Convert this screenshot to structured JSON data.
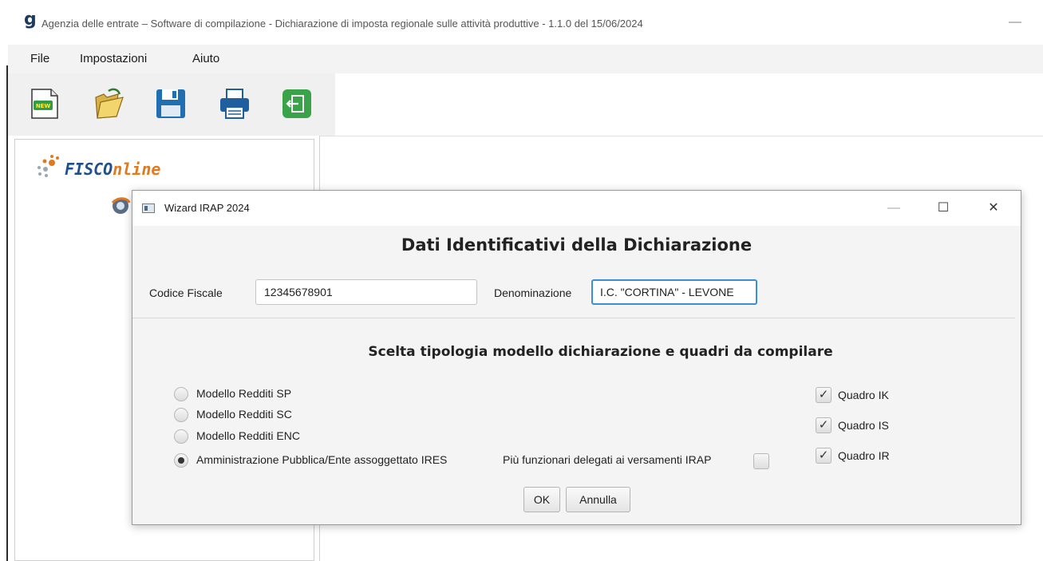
{
  "app": {
    "logo_glyph": "g",
    "title": "Agenzia delle entrate – Software di compilazione - Dichiarazione di imposta regionale sulle attività produttive - 1.1.0 del 15/06/2024",
    "minimize_glyph": "—"
  },
  "menu": {
    "items": [
      "File",
      "Impostazioni",
      "Aiuto"
    ]
  },
  "toolbar": {
    "buttons": [
      {
        "icon": "new-document-icon",
        "badge": "NEW"
      },
      {
        "icon": "open-folder-icon"
      },
      {
        "icon": "save-floppy-icon"
      },
      {
        "icon": "print-icon"
      },
      {
        "icon": "exit-icon"
      }
    ]
  },
  "sidebar": {
    "logo_text_a": "FISCO",
    "logo_text_b": "nline"
  },
  "dialog": {
    "title": "Wizard IRAP 2024",
    "controls": {
      "minimize": "—",
      "maximize": "☐",
      "close": "✕"
    },
    "heading": "Dati Identificativi della Dichiarazione",
    "codice_fiscale_label": "Codice Fiscale",
    "codice_fiscale_value": "12345678901",
    "denominazione_label": "Denominazione",
    "denominazione_value": "I.C. \"CORTINA\" - LEVONE",
    "subheading": "Scelta tipologia modello dichiarazione e quadri da compilare",
    "models": [
      {
        "label": "Modello Redditi SP",
        "checked": false
      },
      {
        "label": "Modello Redditi SC",
        "checked": false
      },
      {
        "label": "Modello Redditi ENC",
        "checked": false
      },
      {
        "label": "Amministrazione Pubblica/Ente assoggettato IRES",
        "checked": true
      }
    ],
    "delegati_label": "Più funzionari delegati ai versamenti IRAP",
    "delegati_checked": false,
    "quadri": [
      {
        "label": "Quadro IK",
        "checked": true
      },
      {
        "label": "Quadro IS",
        "checked": true
      },
      {
        "label": "Quadro IR",
        "checked": true
      }
    ],
    "check_glyph": "✓",
    "ok_label": "OK",
    "cancel_label": "Annulla"
  }
}
